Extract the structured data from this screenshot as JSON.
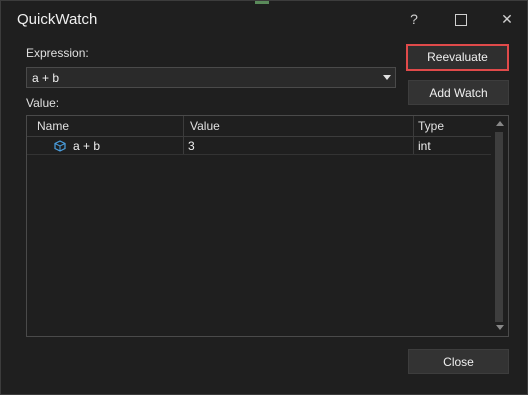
{
  "window": {
    "title": "QuickWatch",
    "help": "?",
    "close_glyph": "✕"
  },
  "expression": {
    "label": "Expression:",
    "value": "a + b"
  },
  "value_label": "Value:",
  "buttons": {
    "reevaluate": "Reevaluate",
    "add_watch": "Add Watch",
    "close": "Close"
  },
  "grid": {
    "columns": [
      "Name",
      "Value",
      "Type"
    ],
    "rows": [
      {
        "name": "a + b",
        "value": "3",
        "type": "int"
      }
    ]
  },
  "colors": {
    "highlight_border": "#e04a4a",
    "icon_blue": "#4a9fe0"
  }
}
